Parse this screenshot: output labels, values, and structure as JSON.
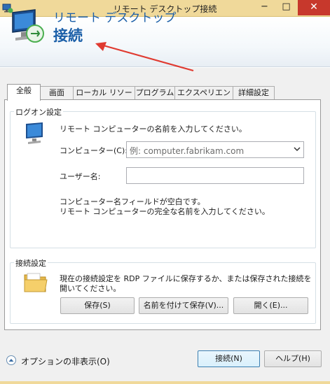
{
  "window": {
    "title": "リモート デスクトップ接続",
    "minimize": "−",
    "maximize": "□",
    "close": "✕"
  },
  "banner": {
    "subtitle": "リモート デスクトップ",
    "title": "接続"
  },
  "tabs": [
    {
      "label": "全般",
      "active": true
    },
    {
      "label": "画面"
    },
    {
      "label": "ローカル リソース"
    },
    {
      "label": "プログラム"
    },
    {
      "label": "エクスペリエンス"
    },
    {
      "label": "詳細設定"
    }
  ],
  "logon": {
    "group_label": "ログオン設定",
    "instruction": "リモート コンピューターの名前を入力してください。",
    "computer_label": "コンピューター(C):",
    "computer_placeholder": "例: computer.fabrikam.com",
    "username_label": "ユーザー名:",
    "username_value": "",
    "note_line1": "コンピューター名フィールドが空白です。",
    "note_line2": "リモート コンピューターの完全な名前を入力してください。"
  },
  "connection": {
    "group_label": "接続設定",
    "description_line1": "現在の接続設定を RDP ファイルに保存するか、または保存された接続を",
    "description_line2": "開いてください。",
    "save_label": "保存(S)",
    "save_as_label": "名前を付けて保存(V)...",
    "open_label": "開く(E)..."
  },
  "footer": {
    "options_label": "オプションの非表示(O)",
    "connect_label": "接続(N)",
    "help_label": "ヘルプ(H)"
  },
  "colors": {
    "titlebar": "#f0d99a",
    "accent_text": "#1b5fa8",
    "close_button": "#c7382c",
    "annotation_arrow": "#e03a30"
  }
}
